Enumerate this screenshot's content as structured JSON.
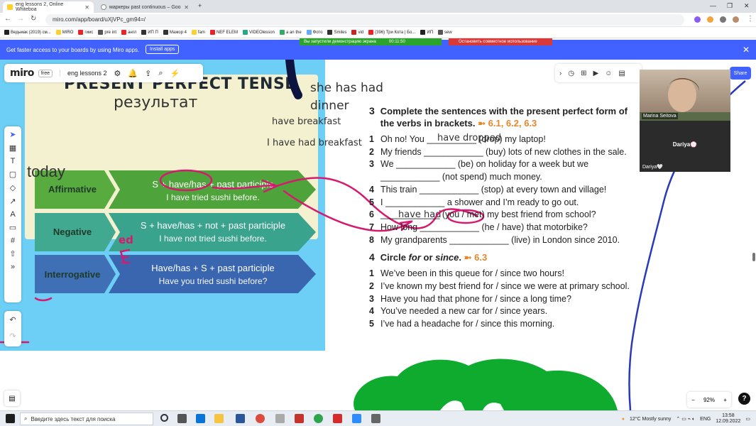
{
  "browser": {
    "tabs": [
      {
        "label": "eng lessons 2, Online Whiteboa",
        "active": true
      },
      {
        "label": "маркеры past continuous – Goo",
        "active": false
      }
    ],
    "url": "miro.com/app/board/uXjVPc_gm94=/",
    "bookmarks": [
      "Ведьмак (2019) см...",
      "MIRO",
      "гиис",
      "pre int",
      "англ",
      "ИП П",
      "Мажор 4",
      "fam",
      "NEF ELEM",
      "VIDEOlesson",
      "a an the",
      "Фото",
      "Smiles",
      "vid",
      "(396) Три Кота | Бо...",
      "ИП",
      "sew"
    ]
  },
  "banner": {
    "text": "Get faster access to your boards by using Miro apps.",
    "install": "Install apps",
    "sharing": "Вы запустили демонстрацию экрана",
    "sharing_time": "00:11:50",
    "stop_sharing": "Остановить совместное использование"
  },
  "miro": {
    "logo": "miro",
    "plan": "free",
    "board_name": "eng lessons 2",
    "share": "Share",
    "zoom": "92%"
  },
  "video": {
    "host": "Marina Seitova",
    "student_name": "Dariya💮",
    "student_label": "Dariya🤍"
  },
  "notes": {
    "result": "результат",
    "she_has_had": "she has had",
    "dinner": "dinner",
    "have_breakfast": "have breakfast",
    "i_have_had_breakfast": "I have had breakfast",
    "today": "today",
    "have_dropped": "have dropped",
    "have_had": "have  had",
    "ed": "ed"
  },
  "infographic": {
    "title": "PRESENT PERFECT TENSE",
    "rows": [
      {
        "label": "Affirmative",
        "formula": "S + have/has + past participle",
        "example": "I have tried sushi before.",
        "color_left": "#58ab3e",
        "color_right": "#4ea33a"
      },
      {
        "label": "Negative",
        "formula": "S + have/has + not + past participle",
        "example": "I have not tried sushi before.",
        "color_left": "#41a98f",
        "color_right": "#3aa38d"
      },
      {
        "label": "Interrogative",
        "formula": "Have/has + S + past participle",
        "example": "Have you tried sushi before?",
        "color_left": "#3f6fb5",
        "color_right": "#3a66b0"
      }
    ]
  },
  "exercise3": {
    "num": "3",
    "title": "Complete the sentences with the present perfect form of the verbs in brackets.",
    "ref": "6.1, 6.2, 6.3",
    "items": [
      {
        "n": "1",
        "text": "Oh no! You __________ (drop) my laptop!"
      },
      {
        "n": "2",
        "text": "My friends ____________ (buy) lots of new clothes in the sale."
      },
      {
        "n": "3",
        "text": "We ____________ (be) on holiday for a week but we ____________ (not spend) much money."
      },
      {
        "n": "4",
        "text": "This train ____________ (stop) at every town and village!"
      },
      {
        "n": "5",
        "text": "I ____________ a shower and I’m ready to go out."
      },
      {
        "n": "6",
        "text": "____________ (you / met) my best friend from school?"
      },
      {
        "n": "7",
        "text": "How long ____________ (he / have) that motorbike?"
      },
      {
        "n": "8",
        "text": "My grandparents ____________ (live) in London since 2010."
      }
    ]
  },
  "exercise4": {
    "num": "4",
    "title_a": "Circle ",
    "title_for": "for",
    "title_or": " or ",
    "title_since": "since",
    "ref": "6.3",
    "items": [
      {
        "n": "1",
        "text": "We’ve been in this queue for / since two hours!"
      },
      {
        "n": "2",
        "text": "I’ve known my best friend for / since we were at primary school."
      },
      {
        "n": "3",
        "text": "Have you had that phone for / since a long time?"
      },
      {
        "n": "4",
        "text": "You’ve needed a new car for / since years."
      },
      {
        "n": "5",
        "text": "I’ve had a headache for / since this morning."
      }
    ]
  },
  "taskbar": {
    "search_placeholder": "Введите здесь текст для поиска",
    "weather": "12°C  Mostly sunny",
    "lang": "ENG",
    "time": "13:58",
    "date": "12.09.2022"
  }
}
